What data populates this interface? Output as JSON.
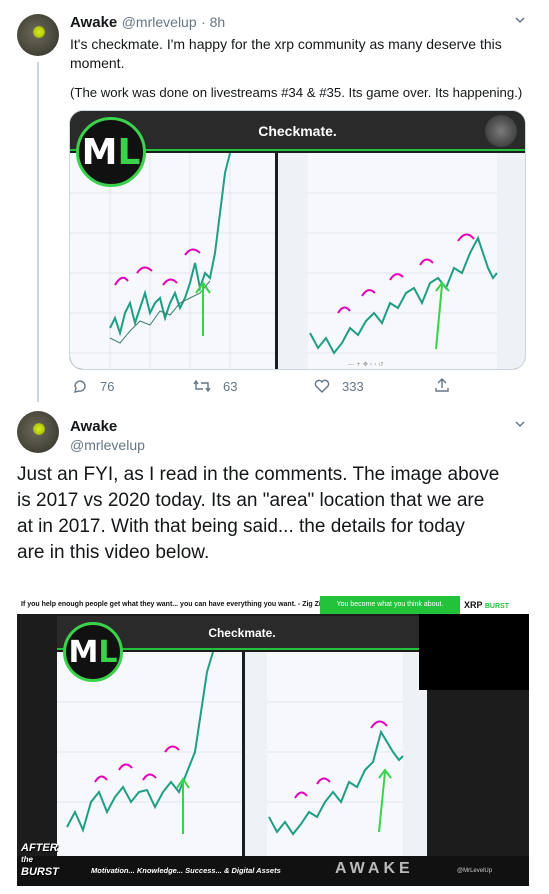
{
  "tweet1": {
    "author_name": "Awake",
    "author_handle": "@mrlevelup",
    "time": "· 8h",
    "text_line1": "It's checkmate. I'm happy for the xrp community as many deserve this",
    "text_line2": "moment.",
    "text_line3": "(The work was done on livestreams #34 & #35. Its game over. Its happening.)",
    "media": {
      "banner_title": "Checkmate.",
      "logo_text_m": "M",
      "logo_text_l": "L"
    },
    "actions": {
      "reply_count": "76",
      "retweet_count": "63",
      "like_count": "333"
    }
  },
  "tweet2": {
    "author_name": "Awake",
    "author_handle": "@mrlevelup",
    "text_line1": "Just an FYI, as I read in the comments. The image above",
    "text_line2": "is 2017 vs 2020 today. Its an \"area\" location that we are",
    "text_line3": "at in 2017. With that being said... the details for today",
    "text_line4": "are in this video below.",
    "video": {
      "top_quote": "If you help enough people get what they want... you can have everything you want. - Zig Ziglar",
      "top_green": "You become what you think about.",
      "brand_xrp": "XRP",
      "brand_burst": "BURST",
      "banner_title": "Checkmate.",
      "logo_text_m": "M",
      "logo_text_l": "L",
      "bottom_logo_line1": "AFTER",
      "bottom_logo_line2": "the",
      "bottom_logo_line3": "BURST",
      "bottom_tagline": "Motivation... Knowledge... Success... & Digital Assets",
      "bottom_watermark": "AWAKE",
      "bottom_handle": "@MrLevelUp"
    }
  },
  "colors": {
    "accent_green": "#22c33b",
    "link_gray": "#657786",
    "candle_teal": "#1f9e86",
    "arc_magenta": "#e400b8"
  }
}
